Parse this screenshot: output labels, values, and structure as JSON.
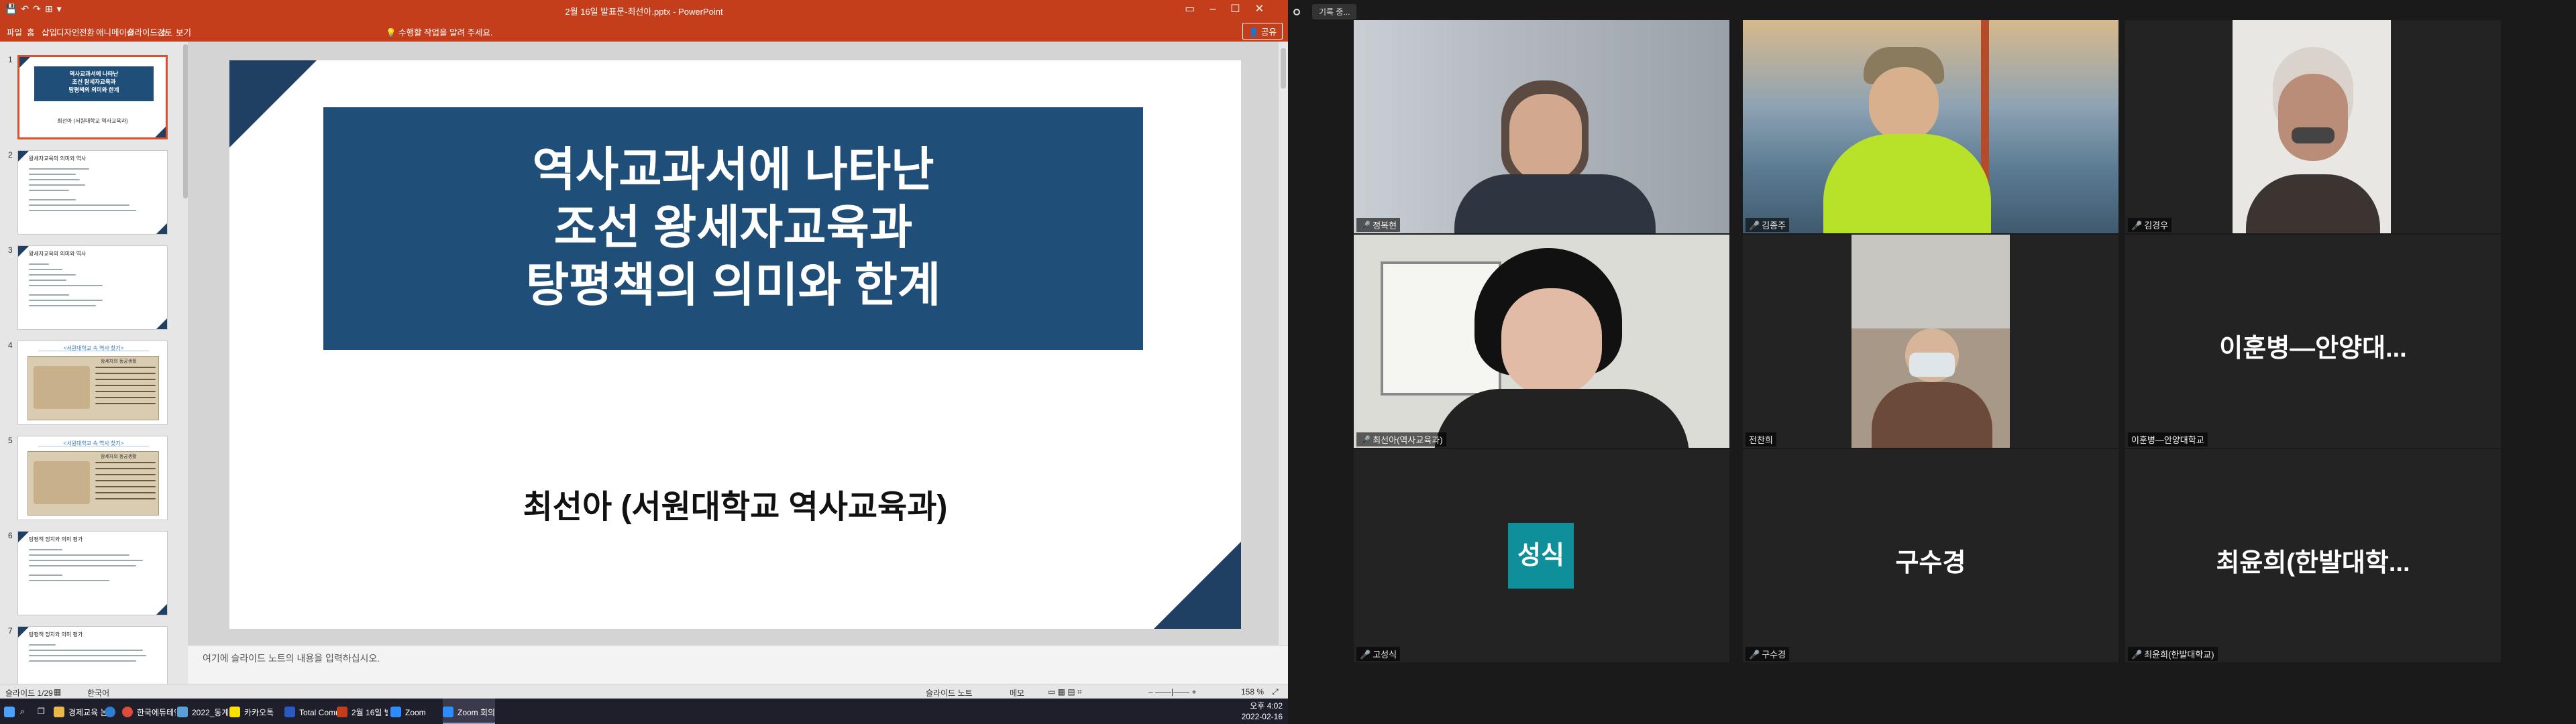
{
  "ppt": {
    "window_title": "2월 16일 발표문-최선아.pptx - PowerPoint",
    "ribbon_tabs": [
      "파일",
      "홈",
      "삽입",
      "디자인",
      "전환",
      "애니메이션",
      "슬라이드 쇼",
      "검토",
      "보기"
    ],
    "search_label": "수행할 작업을 알려 주세요.",
    "share_label": "공유",
    "thumbnails": {
      "t1": {
        "num": "1",
        "line1": "역사교과서에 나타난",
        "line2": "조선 왕세자교육과",
        "line3": "탕평책의 의미와 한계",
        "sub": "최선아 (서원대학교 역사교육과)"
      },
      "t2": {
        "num": "2",
        "title": "왕세자교육의 의미와 역사"
      },
      "t3": {
        "num": "3",
        "title": "왕세자교육의 의미와 역사"
      },
      "t4": {
        "num": "4",
        "title": "<서원대학교 속 역사 찾기>",
        "head": "왕세자의 동궁생활"
      },
      "t5": {
        "num": "5",
        "title": "<서원대학교 속 역사 찾기>",
        "head": "왕세자의 동궁생활"
      },
      "t6": {
        "num": "6",
        "title": "탕평책 정치와 의미 평가"
      },
      "t7": {
        "num": "7",
        "title": "탕평책 정치와 의미 평가"
      }
    },
    "slide": {
      "title_l1": "역사교과서에 나타난",
      "title_l2": "조선 왕세자교육과",
      "title_l3": "탕평책의 의미와 한계",
      "subtitle": "최선아 (서원대학교 역사교육과)"
    },
    "notes_placeholder": "여기에 슬라이드 노트의 내용을 입력하십시오.",
    "status": {
      "slide_count": "슬라이드 1/29",
      "language": "한국어",
      "notes_btn": "슬라이드 노트",
      "comments_btn": "메모",
      "zoom": "158 %"
    }
  },
  "taskbar": {
    "items": [
      "경제교육 논문자료",
      "한국에듀테인먼트...",
      "2022_동계_학술...",
      "카카오톡",
      "Total Commander...",
      "2월 16일 발표문...",
      "Zoom",
      "Zoom 회의"
    ],
    "time": "오후 4:02",
    "date": "2022-02-16"
  },
  "zoom": {
    "record_label": "기록 중...",
    "participants": [
      {
        "name": "정복현",
        "big": ""
      },
      {
        "name": "김종주",
        "big": ""
      },
      {
        "name": "김경우",
        "big": ""
      },
      {
        "name": "최선아(역사교육과)",
        "big": ""
      },
      {
        "name": "전찬희",
        "big": ""
      },
      {
        "name": "이훈병—안양대학교",
        "big": "이훈병—안양대..."
      },
      {
        "name": "고성식",
        "big": "",
        "avatar": "성식"
      },
      {
        "name": "구수경",
        "big": "구수경"
      },
      {
        "name": "최윤희(한발대학교)",
        "big": "최윤희(한발대학..."
      }
    ]
  },
  "colors": {
    "ppt_accent": "#c43e1c",
    "slide_navy": "#1f4e79",
    "zoom_speaker": "#c6e24a",
    "avatar_teal": "#0f8f99"
  }
}
